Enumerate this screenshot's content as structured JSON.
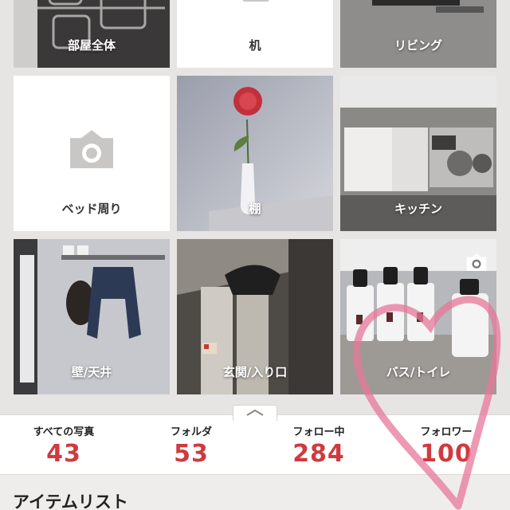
{
  "folders": [
    {
      "label": "部屋全体"
    },
    {
      "label": "机"
    },
    {
      "label": "リビング"
    },
    {
      "label": "ベッド周り"
    },
    {
      "label": "棚"
    },
    {
      "label": "キッチン"
    },
    {
      "label": "壁/天井"
    },
    {
      "label": "玄関/入り口"
    },
    {
      "label": "バス/トイレ"
    }
  ],
  "stats": [
    {
      "label": "すべての写真",
      "value": "43"
    },
    {
      "label": "フォルダ",
      "value": "53"
    },
    {
      "label": "フォロー中",
      "value": "284"
    },
    {
      "label": "フォロワー",
      "value": "100"
    }
  ],
  "items_section": {
    "title": "アイテムリスト"
  },
  "colors": {
    "accent": "#d03a3f",
    "heart": "#e8779a",
    "background": "#e7e5e3"
  },
  "icons": {
    "camera": "camera-icon",
    "collapse": "chevron-up-icon"
  }
}
